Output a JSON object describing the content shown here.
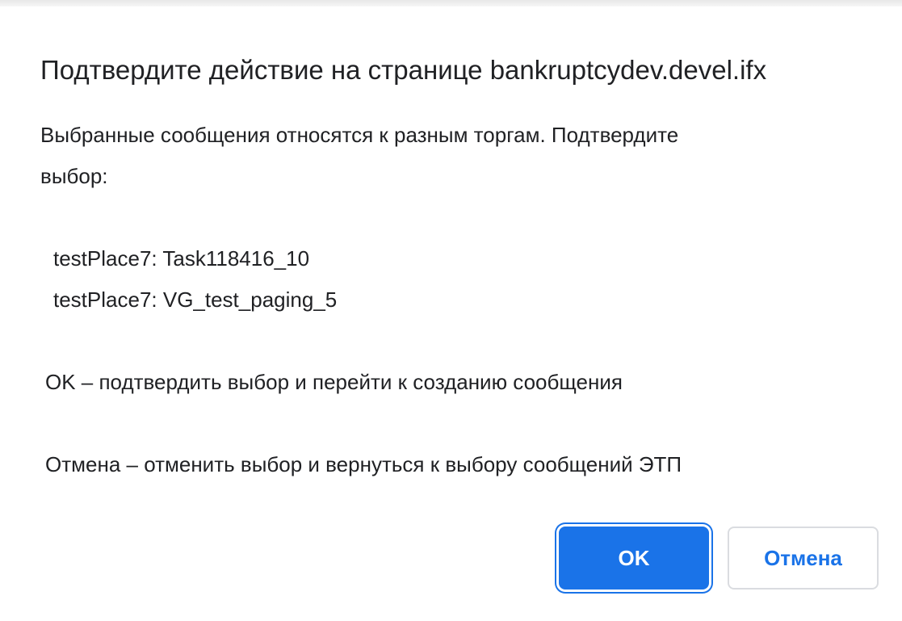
{
  "dialog": {
    "title": "Подтвердите действие на странице bankruptcydev.devel.ifx",
    "message": {
      "intro_line1": "Выбранные сообщения относятся к разным торгам. Подтвердите",
      "intro_line2": "выбор:",
      "items": [
        "testPlace7: Task118416_10",
        "testPlace7: VG_test_paging_5"
      ],
      "ok_hint": "OK – подтвердить выбор и перейти к созданию сообщения",
      "cancel_hint": "Отмена – отменить выбор и вернуться к выбору сообщений ЭТП"
    },
    "buttons": {
      "ok_label": "OK",
      "cancel_label": "Отмена"
    }
  },
  "colors": {
    "accent": "#1a73e8",
    "text": "#202124",
    "button_border": "#dadce0"
  }
}
